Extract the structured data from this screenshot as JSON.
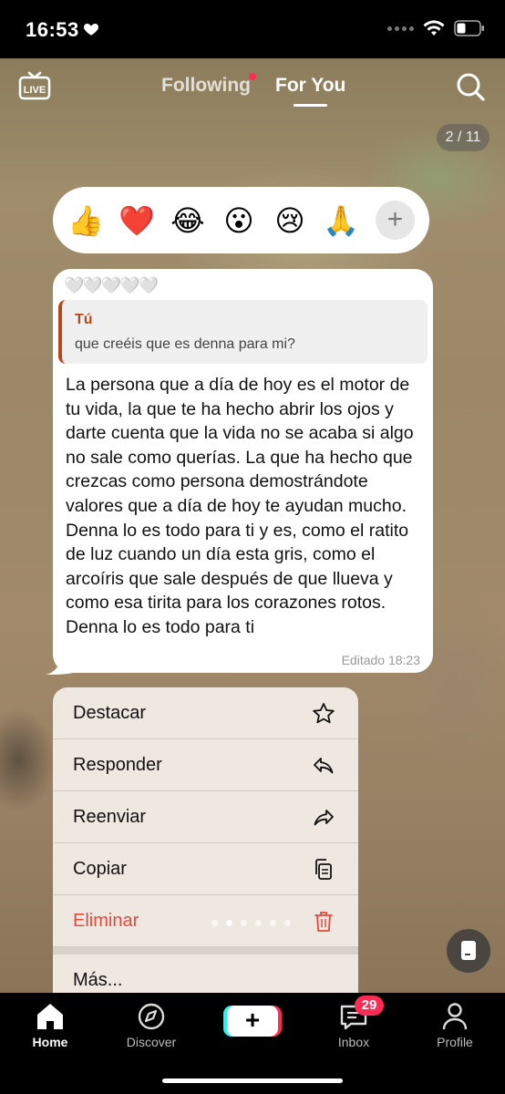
{
  "status_bar": {
    "time": "16:53"
  },
  "top_nav": {
    "live_label": "LIVE",
    "tab_following": "Following",
    "tab_for_you": "For You",
    "page_indicator": "2 / 11"
  },
  "reactions": {
    "emojis": [
      "👍",
      "❤️",
      "😂",
      "😮",
      "😢",
      "🙏"
    ],
    "add_label": "+"
  },
  "message": {
    "hearts": "🤍🤍🤍🤍🤍",
    "quote_author": "Tú",
    "quote_text": "que creéis que es denna para mi?",
    "body": "La persona que a día de hoy es el motor de tu vida, la que te ha hecho abrir los ojos y darte cuenta que la vida no se acaba si algo no sale como querías. La que ha hecho que crezcas como persona demostrándote valores que a día de hoy te ayudan mucho. Denna lo es todo para ti y es, como el ratito de luz cuando un día esta gris, como el arcoíris que sale después de que llueva y como esa tirita para los corazones rotos. Denna lo es todo para ti",
    "meta": "Editado  18:23"
  },
  "context_menu": {
    "items": [
      {
        "label": "Destacar",
        "icon": "star-icon"
      },
      {
        "label": "Responder",
        "icon": "reply-icon"
      },
      {
        "label": "Reenviar",
        "icon": "forward-icon"
      },
      {
        "label": "Copiar",
        "icon": "copy-icon"
      },
      {
        "label": "Eliminar",
        "icon": "trash-icon"
      }
    ],
    "more_label": "Más..."
  },
  "bottom_nav": {
    "home": "Home",
    "discover": "Discover",
    "create": "+",
    "inbox": "Inbox",
    "inbox_badge": "29",
    "profile": "Profile"
  },
  "colors": {
    "accent_red": "#fe2c55",
    "accent_cyan": "#25f4ee",
    "quote_accent": "#b8481b",
    "danger": "#e5483e"
  }
}
